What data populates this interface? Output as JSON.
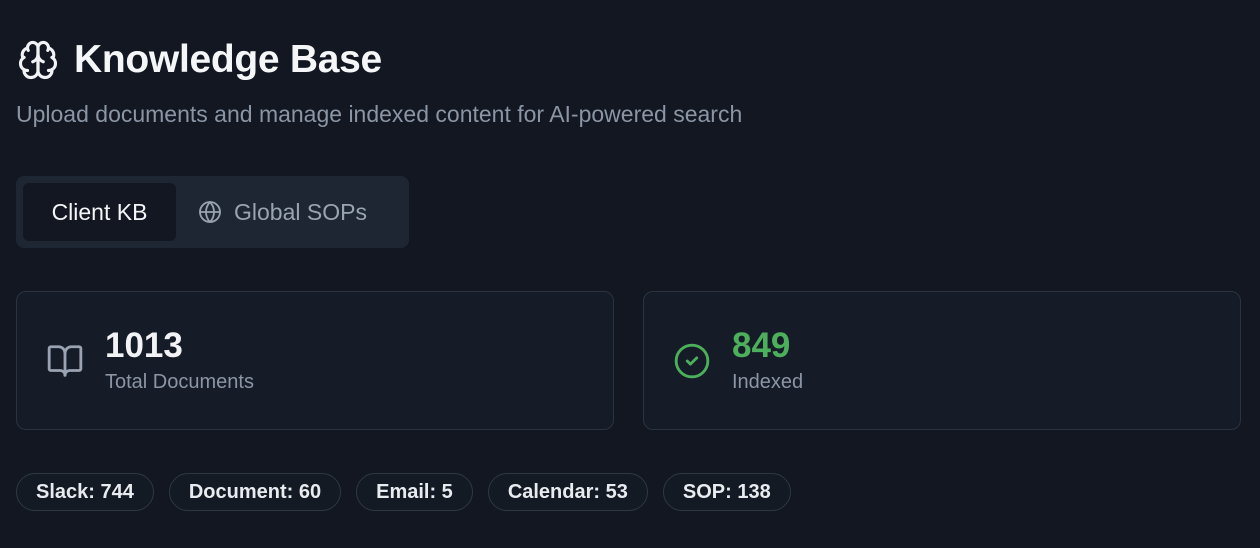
{
  "header": {
    "title": "Knowledge Base",
    "subtitle": "Upload documents and manage indexed content for AI-powered search",
    "icon": "brain-icon"
  },
  "tabs": [
    {
      "label": "Client KB",
      "active": true
    },
    {
      "label": "Global SOPs",
      "active": false,
      "icon": "globe-icon"
    }
  ],
  "stats": {
    "total": {
      "value": "1013",
      "label": "Total Documents",
      "icon": "book-open-icon"
    },
    "indexed": {
      "value": "849",
      "label": "Indexed",
      "icon": "check-circle-icon",
      "color": "#4caf5b"
    }
  },
  "chips": [
    {
      "label": "Slack: 744"
    },
    {
      "label": "Document: 60"
    },
    {
      "label": "Email: 5"
    },
    {
      "label": "Calendar: 53"
    },
    {
      "label": "SOP: 138"
    }
  ]
}
